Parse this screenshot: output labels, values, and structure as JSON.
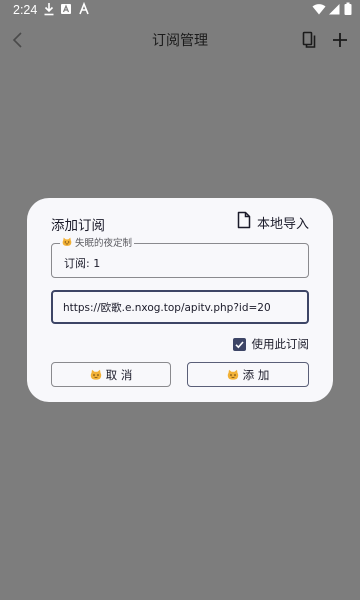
{
  "status_bar": {
    "time": "2:24"
  },
  "app_bar": {
    "title": "订阅管理"
  },
  "dialog": {
    "title": "添加订阅",
    "import_label": "本地导入",
    "subscription_box": {
      "legend": "失眠的夜定制",
      "value": "订阅: 1"
    },
    "url_input": {
      "value": "https://欧歌.e.nxog.top/apitv.php?id=20"
    },
    "use_subscription": {
      "label": "使用此订阅",
      "checked": true
    },
    "cancel_label": "取 消",
    "add_label": "添 加"
  },
  "colors": {
    "scrim": "#7d7d7d",
    "accent": "#3d4566",
    "dialog_bg": "#f8f8fb"
  }
}
